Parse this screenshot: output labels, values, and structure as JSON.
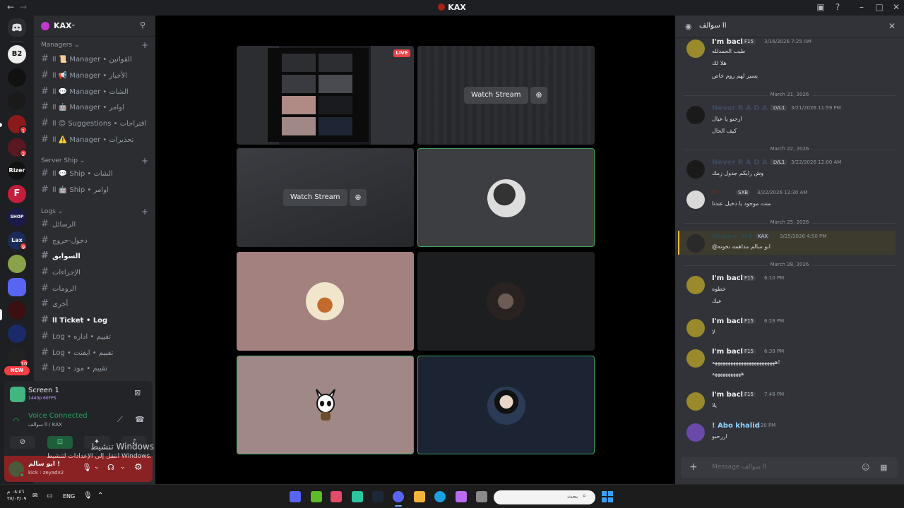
{
  "titlebar": {
    "title": "KAX",
    "back": "←",
    "forward": "→"
  },
  "rail": {
    "home_icon": "discord-icon",
    "servers": [
      {
        "label": "B2",
        "badge": ""
      },
      {
        "label": "",
        "badge": ""
      },
      {
        "label": "",
        "badge": ""
      },
      {
        "label": "",
        "badge": "1"
      },
      {
        "label": "",
        "badge": "2"
      },
      {
        "label": "Rizer",
        "badge": ""
      },
      {
        "label": "F",
        "badge": ""
      },
      {
        "label": "SHOP",
        "badge": ""
      },
      {
        "label": "Lax",
        "badge": "9"
      },
      {
        "label": "",
        "badge": ""
      },
      {
        "label": "",
        "badge": ""
      },
      {
        "label": "",
        "badge": ""
      },
      {
        "label": "",
        "badge": ""
      },
      {
        "label": "",
        "badge": "10"
      }
    ],
    "new_badge": "NEW"
  },
  "guild": {
    "name": "KAX",
    "categories": [
      {
        "name": "Managers",
        "channels": [
          {
            "label": "ll 📜 Manager • القوانين"
          },
          {
            "label": "ll 📢 Manager • الأخبار"
          },
          {
            "label": "ll 💬 Manager • الشات"
          },
          {
            "label": "ll 🤖 Manager • اوامر"
          },
          {
            "label": "ll 😊 Suggestions • اقتراحات"
          },
          {
            "label": "ll ⚠️ Manager • تحذيرات"
          }
        ]
      },
      {
        "name": "Server Ship",
        "channels": [
          {
            "label": "ll 💬 Ship • الشات"
          },
          {
            "label": "ll 🤖 Ship • اوامر"
          }
        ]
      },
      {
        "name": "Logs",
        "channels": [
          {
            "label": "الرسائل"
          },
          {
            "label": "دخول-خروج"
          },
          {
            "label": "السوابق"
          },
          {
            "label": "الإجراءات"
          },
          {
            "label": "الرومات"
          },
          {
            "label": "أخرى"
          },
          {
            "label": "ll Ticket • Log"
          },
          {
            "label": "Log • تقييم • اداره"
          },
          {
            "label": "Log • تقييم • ايفنت"
          },
          {
            "label": "Log • تقييم • مود"
          }
        ]
      }
    ]
  },
  "stream_panel": {
    "title": "Screen 1",
    "quality": "1440p 60FPS",
    "voice_status": "Voice Connected",
    "voice_channel": "سوالف ll / KAX"
  },
  "user": {
    "name": "ابو سالم !",
    "status": "kick : zeyadx2"
  },
  "activate_windows": {
    "line1": "تنشيط Windows",
    "line2": "انتقل إلى الإعدادات لتنشيط Windows."
  },
  "stage": {
    "live_label": "LIVE",
    "watch_label": "Watch Stream"
  },
  "chat": {
    "channel": "سوالف ll",
    "messages": [
      {
        "name": "I'm back",
        "tag": "F15",
        "time": "3/16/2026 7:25 AM",
        "lines": [
          "طيب الحمدلله",
          "هلا لك",
          "يسير لهم روم خاص"
        ]
      },
      {
        "date": "March 21, 2026"
      },
      {
        "name": "Never R A D A R",
        "tag": "LVL1",
        "time": "3/21/2026 11:59 PM",
        "lines": [
          "ارحبو يا عيال",
          "كيف الحال"
        ]
      },
      {
        "date": "March 22, 2026"
      },
      {
        "name": "Never R A D A R",
        "tag": "LVL1",
        "time": "3/22/2026 12:00 AM",
        "lines": [
          "وش رايكم جدول زمك"
        ]
      },
      {
        "name": "",
        "tag": "SXB",
        "time": "3/22/2026 12:30 AM",
        "lines": [
          "منت موجود يا دخيل عندنا"
        ]
      },
      {
        "date": "March 25, 2026"
      },
      {
        "name": "Nabee_M43",
        "tag": "KAX",
        "time": "3/25/2026 4:50 PM",
        "lines": [
          "@ابو سالم مداهمه نخونه"
        ]
      },
      {
        "date": "March 28, 2026"
      },
      {
        "name": "I'm back",
        "tag": "F15",
        "time": "6:10 PM",
        "lines": [
          "خطوه",
          "عيك"
        ]
      },
      {
        "name": "I'm back",
        "tag": "F15",
        "time": "6:28 PM",
        "lines": [
          "لا"
        ]
      },
      {
        "name": "I'm back",
        "tag": "F15",
        "time": "6:39 PM",
        "lines": [
          "ههههههههههههههههههههههههه!",
          "هههههههههههه"
        ]
      },
      {
        "name": "I'm back",
        "tag": "F15",
        "time": "7:48 PM",
        "lines": [
          "يلا"
        ]
      },
      {
        "name": "! Abo khalid",
        "tag": "",
        "time": "8:20 PM",
        "lines": [
          "اررحبو"
        ]
      }
    ],
    "composer_placeholder": "Message سوالف ll"
  },
  "taskbar": {
    "time": "٠٨:٤٦ م",
    "date": "٢٧/٠٣/٠٩",
    "lang": "ENG",
    "search_placeholder": "بحث"
  },
  "colors": {
    "accent_green": "#3ba55c",
    "blurple": "#5865f2",
    "danger": "#f23f43"
  }
}
